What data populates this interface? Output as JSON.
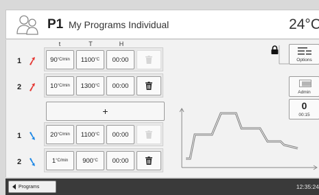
{
  "header": {
    "program_id": "P1",
    "program_name": "My Programs Individual",
    "temperature": "24°C"
  },
  "columns": {
    "t": "t",
    "T": "T",
    "H": "H"
  },
  "heating_rows": [
    {
      "num": "1",
      "t_value": "90",
      "t_unit": "°C/min",
      "T_value": "1100",
      "T_unit": "°C",
      "H": "00:00",
      "delete_enabled": false
    },
    {
      "num": "2",
      "t_value": "10",
      "t_unit": "°C/min",
      "T_value": "1300",
      "T_unit": "°C",
      "H": "00:00",
      "delete_enabled": true
    }
  ],
  "add_label": "+",
  "cooling_rows": [
    {
      "num": "1",
      "t_value": "20",
      "t_unit": "°C/min",
      "T_value": "1100",
      "T_unit": "°C",
      "H": "00:00",
      "delete_enabled": false
    },
    {
      "num": "2",
      "t_value": "1",
      "t_unit": "°C/min",
      "T_value": "900",
      "T_unit": "°C",
      "H": "00:00",
      "delete_enabled": true
    }
  ],
  "side": {
    "options_label": "Options",
    "admin_label": "Admin",
    "timer_value": "0",
    "timer_time": "00:15"
  },
  "footer": {
    "programs_label": "Programs",
    "clock": "12:35:24"
  },
  "colors": {
    "heat_arrow": "#e53935",
    "cool_arrow": "#1e88e5",
    "footer_bg": "#3a3a3a"
  },
  "icons": [
    "user-icon",
    "heat-arrow-icon",
    "cool-arrow-icon",
    "trash-icon",
    "lock-icon",
    "options-icon",
    "admin-icon",
    "back-arrow-icon"
  ]
}
